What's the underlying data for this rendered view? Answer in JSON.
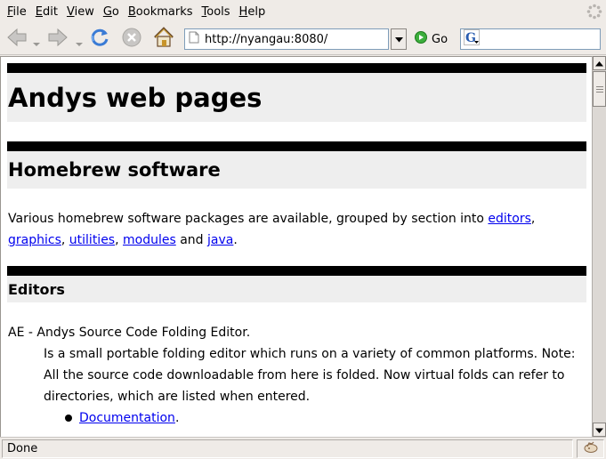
{
  "menu": {
    "items": [
      {
        "first": "F",
        "rest": "ile"
      },
      {
        "first": "E",
        "rest": "dit"
      },
      {
        "first": "V",
        "rest": "iew"
      },
      {
        "first": "G",
        "rest": "o"
      },
      {
        "first": "B",
        "rest": "ookmarks"
      },
      {
        "first": "T",
        "rest": "ools"
      },
      {
        "first": "H",
        "rest": "elp"
      }
    ]
  },
  "toolbar": {
    "url": "http://nyangau:8080/",
    "go_label": "Go",
    "search_value": ""
  },
  "page": {
    "title": "Andys web pages",
    "section_title": "Homebrew software",
    "intro_text": "Various homebrew software packages are available, grouped by section into ",
    "links": {
      "editors": "editors",
      "graphics": "graphics",
      "utilities": "utilities",
      "modules": "modules",
      "java": "java"
    },
    "sep_comma": ",",
    "sep_and": " and ",
    "end_period": ".",
    "subsection_title": "Editors",
    "ae_title": "AE - Andys Source Code Folding Editor.",
    "ae_description": "Is a small portable folding editor which runs on a variety of common platforms. Note: All the source code downloadable from here is folded. Now virtual folds can refer to directories, which are listed when entered.",
    "doc_link": "Documentation",
    "doc_period": "."
  },
  "status": {
    "text": "Done"
  }
}
